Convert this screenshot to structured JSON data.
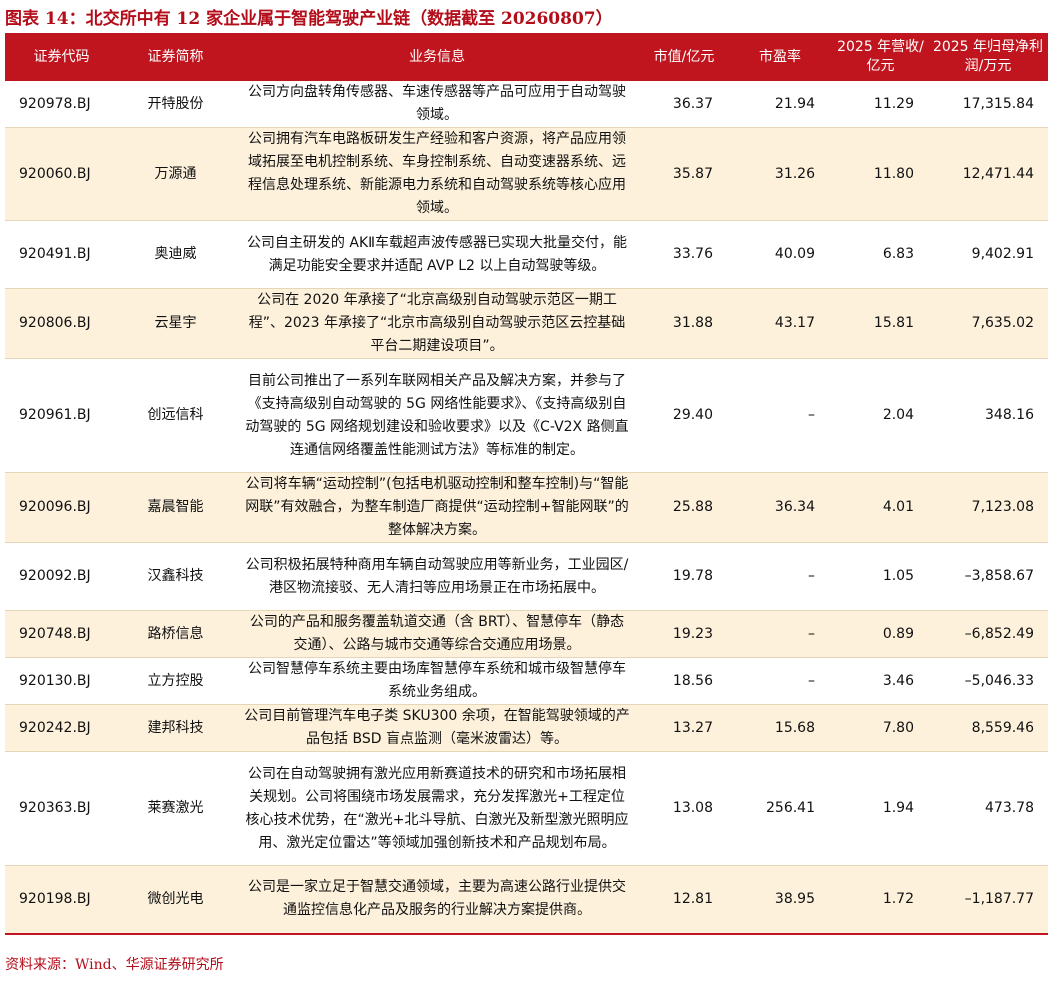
{
  "title": "图表 14：北交所中有 12 家企业属于智能驾驶产业链（数据截至 20260807）",
  "columns": {
    "code": "证券代码",
    "name": "证券简称",
    "business": "业务信息",
    "mktcap": "市值/亿元",
    "pe": "市盈率",
    "revenue": "2025 年营收/亿元",
    "profit": "2025 年归母净利润/万元"
  },
  "rows": [
    {
      "code": "920978.BJ",
      "name": "开特股份",
      "business": "公司方向盘转角传感器、车速传感器等产品可应用于自动驾驶领域。",
      "mktcap": "36.37",
      "pe": "21.94",
      "revenue": "11.29",
      "profit": "17,315.84"
    },
    {
      "code": "920060.BJ",
      "name": "万源通",
      "business": "公司拥有汽车电路板研发生产经验和客户资源，将产品应用领域拓展至电机控制系统、车身控制系统、自动变速器系统、远程信息处理系统、新能源电力系统和自动驾驶系统等核心应用领域。",
      "mktcap": "35.87",
      "pe": "31.26",
      "revenue": "11.80",
      "profit": "12,471.44"
    },
    {
      "code": "920491.BJ",
      "name": "奥迪威",
      "business": "公司自主研发的 AKⅡ车载超声波传感器已实现大批量交付，能满足功能安全要求并适配 AVP L2 以上自动驾驶等级。",
      "mktcap": "33.76",
      "pe": "40.09",
      "revenue": "6.83",
      "profit": "9,402.91"
    },
    {
      "code": "920806.BJ",
      "name": "云星宇",
      "business": "公司在 2020 年承接了“北京高级别自动驾驶示范区一期工程”、2023 年承接了“北京市高级别自动驾驶示范区云控基础平台二期建设项目”。",
      "mktcap": "31.88",
      "pe": "43.17",
      "revenue": "15.81",
      "profit": "7,635.02"
    },
    {
      "code": "920961.BJ",
      "name": "创远信科",
      "business": "目前公司推出了一系列车联网相关产品及解决方案，并参与了《支持高级别自动驾驶的 5G 网络性能要求》、《支持高级别自动驾驶的 5G 网络规划建设和验收要求》以及《C-V2X 路侧直连通信网络覆盖性能测试方法》等标准的制定。",
      "mktcap": "29.40",
      "pe": "–",
      "revenue": "2.04",
      "profit": "348.16"
    },
    {
      "code": "920096.BJ",
      "name": "嘉晨智能",
      "business": "公司将车辆“运动控制”(包括电机驱动控制和整车控制)与“智能网联”有效融合，为整车制造厂商提供“运动控制+智能网联”的整体解决方案。",
      "mktcap": "25.88",
      "pe": "36.34",
      "revenue": "4.01",
      "profit": "7,123.08"
    },
    {
      "code": "920092.BJ",
      "name": "汉鑫科技",
      "business": "公司积极拓展特种商用车辆自动驾驶应用等新业务，工业园区/港区物流接驳、无人清扫等应用场景正在市场拓展中。",
      "mktcap": "19.78",
      "pe": "–",
      "revenue": "1.05",
      "profit": "–3,858.67"
    },
    {
      "code": "920748.BJ",
      "name": "路桥信息",
      "business": "公司的产品和服务覆盖轨道交通（含 BRT）、智慧停车（静态交通）、公路与城市交通等综合交通应用场景。",
      "mktcap": "19.23",
      "pe": "–",
      "revenue": "0.89",
      "profit": "–6,852.49"
    },
    {
      "code": "920130.BJ",
      "name": "立方控股",
      "business": "公司智慧停车系统主要由场库智慧停车系统和城市级智慧停车系统业务组成。",
      "mktcap": "18.56",
      "pe": "–",
      "revenue": "3.46",
      "profit": "–5,046.33"
    },
    {
      "code": "920242.BJ",
      "name": "建邦科技",
      "business": "公司目前管理汽车电子类 SKU300 余项，在智能驾驶领域的产品包括 BSD 盲点监测（毫米波雷达）等。",
      "mktcap": "13.27",
      "pe": "15.68",
      "revenue": "7.80",
      "profit": "8,559.46"
    },
    {
      "code": "920363.BJ",
      "name": "莱赛激光",
      "business": "公司在自动驾驶拥有激光应用新赛道技术的研究和市场拓展相关规划。公司将围绕市场发展需求，充分发挥激光+工程定位核心技术优势，在“激光+北斗导航、白激光及新型激光照明应用、激光定位雷达”等领域加强创新技术和产品规划布局。",
      "mktcap": "13.08",
      "pe": "256.41",
      "revenue": "1.94",
      "profit": "473.78"
    },
    {
      "code": "920198.BJ",
      "name": "微创光电",
      "business": "公司是一家立足于智慧交通领域，主要为高速公路行业提供交通监控信息化产品及服务的行业解决方案提供商。",
      "mktcap": "12.81",
      "pe": "38.95",
      "revenue": "1.72",
      "profit": "–1,187.77"
    }
  ],
  "source": "资料来源：Wind、华源证券研究所",
  "colors": {
    "header_bg": "#c0151e",
    "title": "#b40d1a",
    "row_alt_bg": "#fdf1dc"
  }
}
